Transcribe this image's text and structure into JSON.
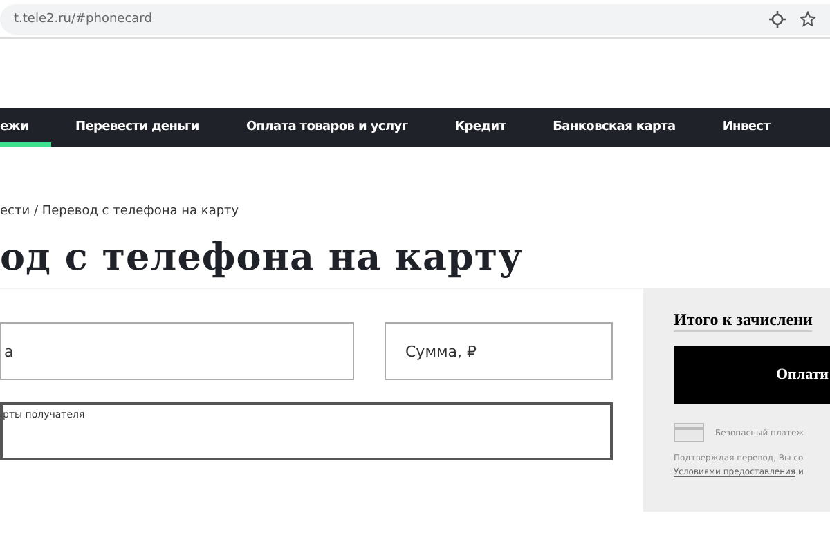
{
  "browser": {
    "address": "t.tele2.ru/#phonecard"
  },
  "nav": [
    {
      "label": "ежи",
      "selected": true
    },
    {
      "label": "Перевести деньги",
      "selected": false
    },
    {
      "label": "Оплата товаров и услуг",
      "selected": false
    },
    {
      "label": "Кредит",
      "selected": false
    },
    {
      "label": "Банковская карта",
      "selected": false
    },
    {
      "label": "Инвест",
      "selected": false
    }
  ],
  "breadcrumb": "ести / Перевод с телефона на карту",
  "title": "од с телефона на карту",
  "form": {
    "phone_field": {
      "placeholder": "а"
    },
    "amount_field": {
      "placeholder": "Сумма, ₽"
    },
    "card_field": {
      "label": "рты получателя"
    }
  },
  "summary": {
    "title": "Итого к зачислени",
    "pay_button": "Оплати",
    "secure": "Безопасный платеж",
    "terms": "Подтверждая перевод, Вы со",
    "terms_link": "Условиями предоставления",
    "terms_tail": "и"
  }
}
